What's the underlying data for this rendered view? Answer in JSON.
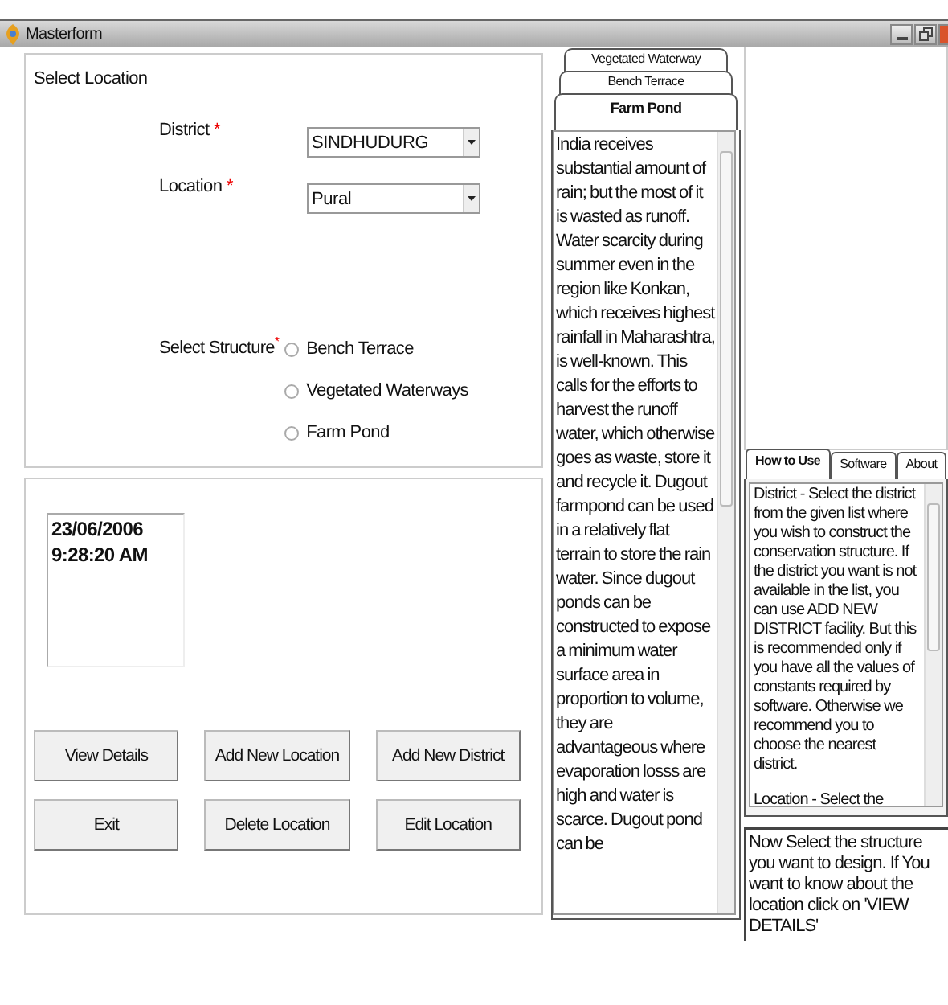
{
  "window": {
    "title": "Masterform"
  },
  "location_panel": {
    "title": "Select Location",
    "fields": [
      {
        "label": "District",
        "marker": "*",
        "value": "SINDHUDURG"
      },
      {
        "label": "Location",
        "marker": "*",
        "value": "Pural"
      }
    ],
    "structure": {
      "label": "Select Structure",
      "marker": "*",
      "options": [
        {
          "label": "Bench Terrace",
          "selected": false
        },
        {
          "label": "Vegetated Waterways",
          "selected": false
        },
        {
          "label": "Farm Pond",
          "selected": false
        }
      ]
    }
  },
  "datetime": {
    "date": "23/06/2006",
    "time": "9:28:20 AM"
  },
  "buttons": [
    [
      "View Details",
      "Add New Location",
      "Add New District"
    ],
    [
      "Exit",
      "Delete Location",
      "Edit Location"
    ]
  ],
  "structure_tabs": [
    {
      "label": "Vegetated Waterway",
      "selected": false
    },
    {
      "label": "Bench Terrace",
      "selected": false
    },
    {
      "label": "Farm Pond",
      "selected": true
    }
  ],
  "structure_text": "India receives substantial amount of rain; but the most of it is wasted as runoff. Water scarcity during summer even in the region like Konkan, which receives highest rainfall in Maharashtra, is well-known. This calls for the efforts to harvest the runoff water, which otherwise goes as waste, store it and recycle it. Dugout farmpond can be used in a relatively flat terrain to store the rain water. Since dugout ponds can be constructed to expose a minimum water surface area in proportion to volume, they are advantageous where evaporation losss are high and water is scarce. Dugout pond can be",
  "help_tabs": [
    {
      "label": "How to Use",
      "selected": true
    },
    {
      "label": "Software",
      "selected": false
    },
    {
      "label": "About",
      "selected": false
    }
  ],
  "help_text": [
    "District - Select the district from the given list where you wish to construct the conservation structure. If the district you want is not available in the list, you can use ADD NEW DISTRICT facility. But this is recommended only if you have all the values of constants required by software. Otherwise we recommend you to choose the nearest district.",
    "Location - Select the"
  ],
  "hint": "Now Select the structure you want to design. If You want to know about the location click on 'VIEW DETAILS'"
}
